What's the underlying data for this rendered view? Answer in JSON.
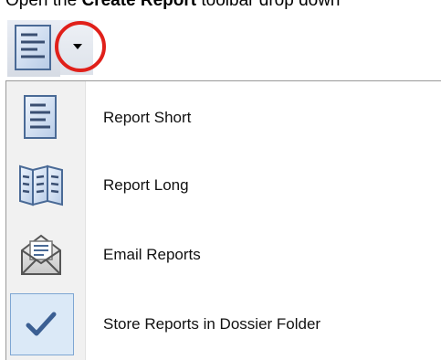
{
  "instruction": {
    "prefix": "Open the ",
    "bold": "Create Report",
    "suffix": " toolbar drop down"
  },
  "toolbar": {
    "button_icon": "report-icon",
    "dropdown_icon": "chevron-down-icon",
    "highlight_color": "#e0201a"
  },
  "menu": {
    "items": [
      {
        "label": "Report Short",
        "icon": "report-short-icon"
      },
      {
        "label": "Report Long",
        "icon": "report-long-icon"
      },
      {
        "label": "Email Reports",
        "icon": "email-envelope-icon"
      },
      {
        "label": "Store Reports in Dossier Folder",
        "icon": "checkmark-icon",
        "checked": true
      }
    ]
  }
}
